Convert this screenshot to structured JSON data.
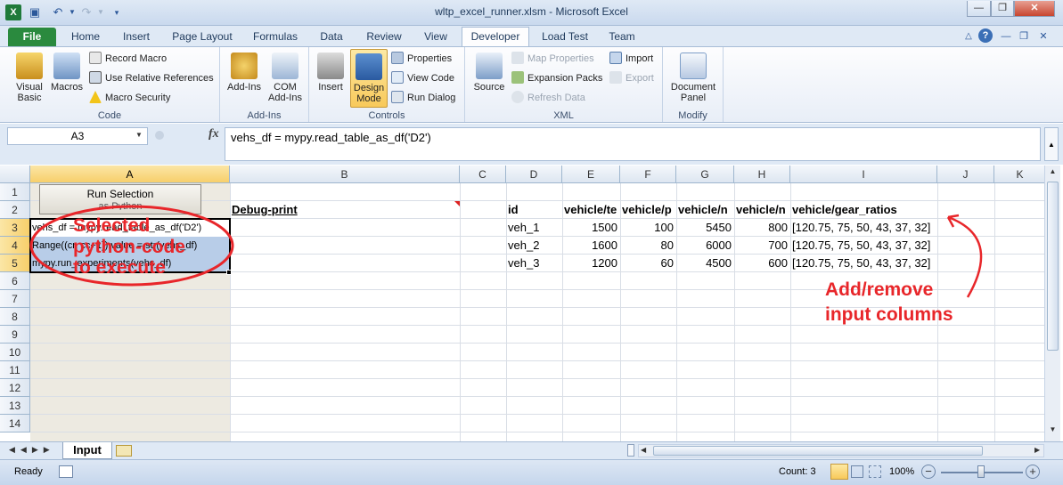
{
  "window": {
    "title": "wltp_excel_runner.xlsm  -  Microsoft Excel"
  },
  "tabs": [
    "File",
    "Home",
    "Insert",
    "Page Layout",
    "Formulas",
    "Data",
    "Review",
    "View",
    "Developer",
    "Load Test",
    "Team"
  ],
  "ribbon": {
    "code": {
      "visual_basic": "Visual Basic",
      "macros": "Macros",
      "record_macro": "Record Macro",
      "relative_refs": "Use Relative References",
      "macro_security": "Macro Security",
      "label": "Code"
    },
    "addins": {
      "addins": "Add-Ins",
      "com_addins": "COM Add-Ins",
      "label": "Add-Ins"
    },
    "controls": {
      "insert": "Insert",
      "design_mode": "Design Mode",
      "properties": "Properties",
      "view_code": "View Code",
      "run_dialog": "Run Dialog",
      "label": "Controls"
    },
    "xml": {
      "source": "Source",
      "map_properties": "Map Properties",
      "expansion_packs": "Expansion Packs",
      "refresh_data": "Refresh Data",
      "import": "Import",
      "export": "Export",
      "label": "XML"
    },
    "modify": {
      "document_panel": "Document Panel",
      "label": "Modify"
    }
  },
  "formula_bar": {
    "name_box": "A3",
    "fx": "fx",
    "formula": "vehs_df = mypy.read_table_as_df('D2')"
  },
  "columns": [
    "A",
    "B",
    "C",
    "D",
    "E",
    "F",
    "G",
    "H",
    "I",
    "J",
    "K"
  ],
  "rows": [
    "1",
    "2",
    "3",
    "4",
    "5",
    "6",
    "7",
    "8",
    "9",
    "10",
    "11",
    "12",
    "13",
    "14"
  ],
  "sheet": {
    "run_button": "Run Selection",
    "run_button_sub": "as Python",
    "a3": "vehs_df = mypy.read_table_as_df('D2')",
    "a4": "Range((cr, cc+1)).value = str(vehs_df)",
    "a5": "mypy.run_experiments(vehs_df)",
    "b2": "Debug-print",
    "headers": [
      "id",
      "vehicle/te",
      "vehicle/p",
      "vehicle/n",
      "vehicle/n",
      "vehicle/gear_ratios"
    ],
    "data": [
      [
        "veh_1",
        "1500",
        "100",
        "5450",
        "800",
        "[120.75, 75, 50, 43, 37, 32]"
      ],
      [
        "veh_2",
        "1600",
        "80",
        "6000",
        "700",
        "[120.75, 75, 50, 43, 37, 32]"
      ],
      [
        "veh_3",
        "1200",
        "60",
        "4500",
        "600",
        "[120.75, 75, 50, 43, 37, 32]"
      ]
    ]
  },
  "annotations": {
    "selected_1": "Selected",
    "selected_2": "python-code",
    "selected_3": "to execute",
    "addremove_1": "Add/remove",
    "addremove_2": "input columns"
  },
  "sheet_tabs": {
    "active": "Input"
  },
  "status": {
    "ready": "Ready",
    "count": "Count: 3",
    "zoom": "100%"
  }
}
